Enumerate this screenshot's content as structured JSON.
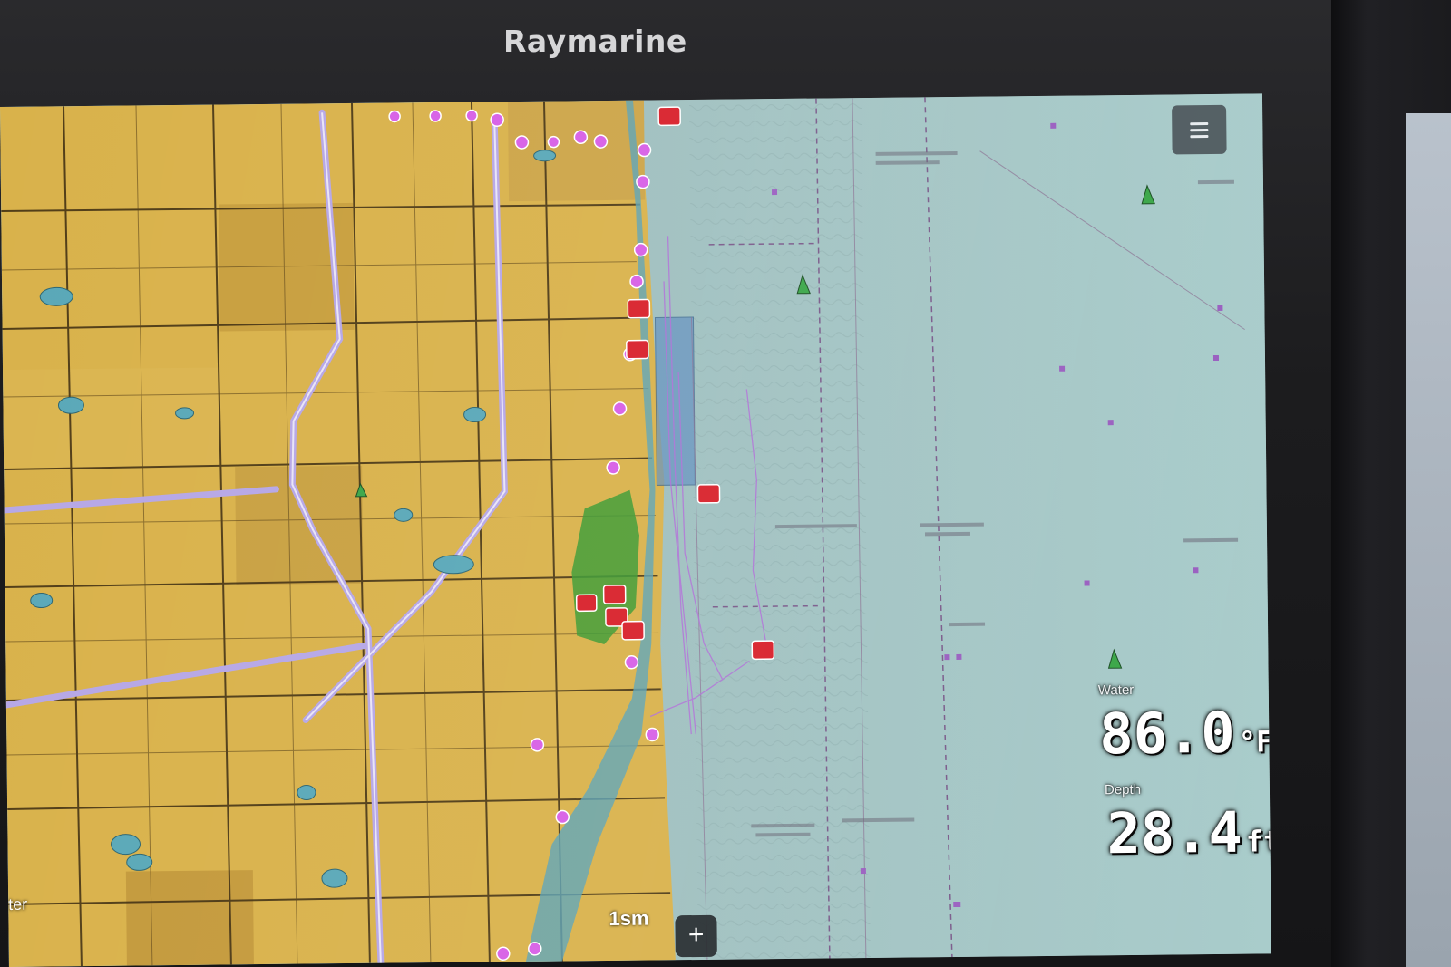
{
  "device": {
    "brand": "Raymarine"
  },
  "chart": {
    "menu_icon": "menu-icon",
    "scale_label": "1sm",
    "zoom_in_label": "+",
    "corner_label": "ter",
    "land_color": "#d8b14a",
    "water_color": "#a9c7c6"
  },
  "data_boxes": {
    "water": {
      "label": "Water",
      "value": "86.0",
      "unit": "°F"
    },
    "depth": {
      "label": "Depth",
      "value": "28.4",
      "unit": "ft"
    }
  }
}
